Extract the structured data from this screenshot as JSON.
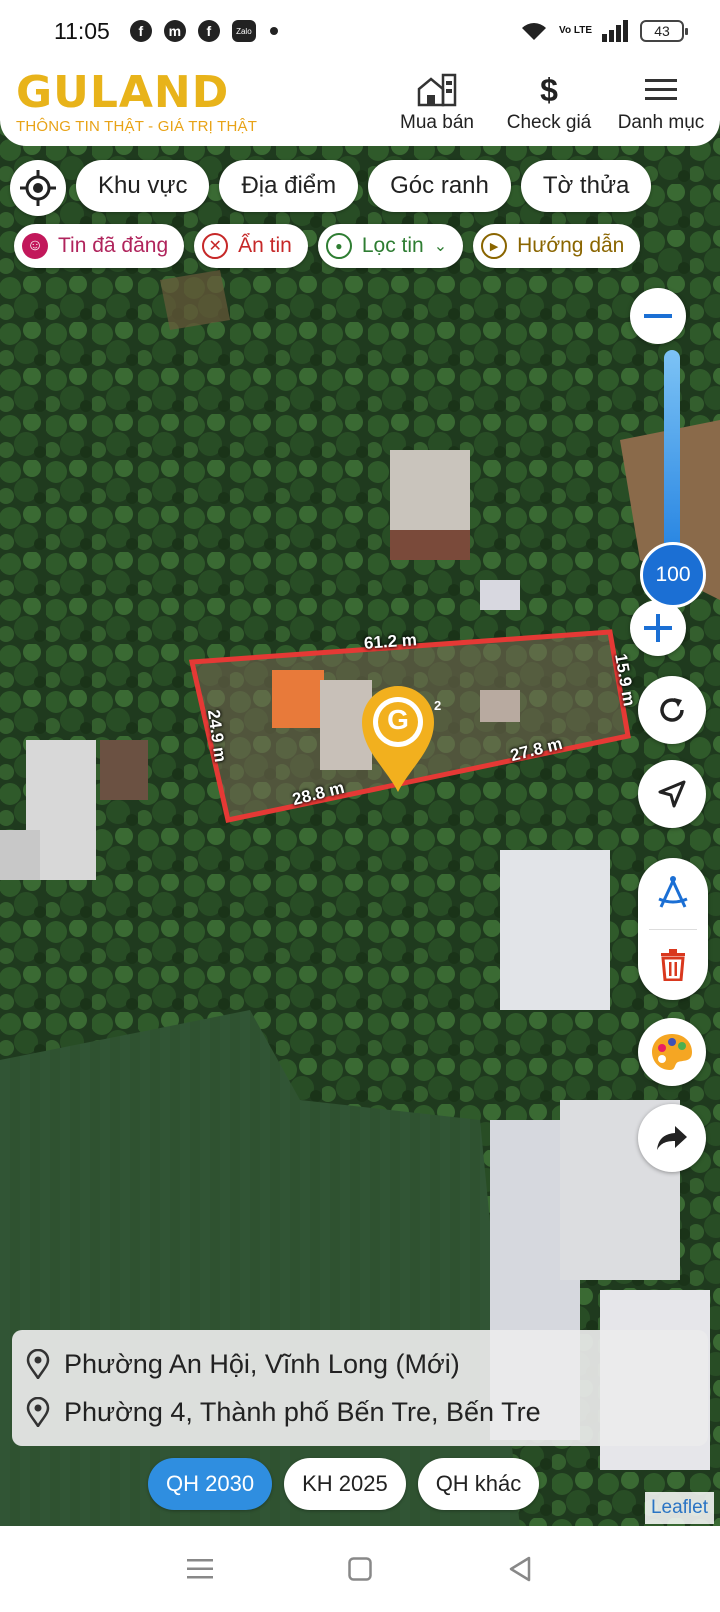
{
  "status_bar": {
    "time": "11:05",
    "notification_icons": [
      "facebook-icon",
      "messenger-icon",
      "facebook-icon",
      "zalo-icon"
    ],
    "zalo_label": "Zalo",
    "volte": "Vo LTE",
    "battery": "43"
  },
  "header": {
    "logo_text": "GULAND",
    "slogan": "THÔNG TIN THẬT - GIÁ TRỊ THẬT",
    "nav": [
      {
        "label": "Mua bán",
        "icon": "buildings-icon"
      },
      {
        "label": "Check giá",
        "icon": "dollar-icon"
      },
      {
        "label": "Danh mục",
        "icon": "menu-icon"
      }
    ]
  },
  "filters": {
    "primary": [
      "Khu vực",
      "Địa điểm",
      "Góc ranh",
      "Tờ thửa"
    ],
    "secondary": [
      {
        "label": "Tin đã đăng",
        "icon": "user-posts-icon",
        "color": "#b0245c"
      },
      {
        "label": "Ẩn tin",
        "icon": "hide-icon",
        "color": "#c62828"
      },
      {
        "label": "Lọc tin",
        "icon": "filter-pin-icon",
        "color": "#2e7d32"
      },
      {
        "label": "Hướng dẫn",
        "icon": "guide-play-icon",
        "color": "#8a6500"
      }
    ]
  },
  "map": {
    "zoom_value": "100",
    "parcel": {
      "edges": [
        "61.2 m",
        "15.9 m",
        "27.8 m",
        "28.8 m",
        "24.9 m"
      ],
      "marker_letter": "G",
      "marker_suffix": "2"
    },
    "boundary_color": "#e53935",
    "attribution": "Leaflet"
  },
  "address": {
    "new": "Phường An Hội, Vĩnh Long (Mới)",
    "old": "Phường 4, Thành phố Bến Tre, Bến Tre"
  },
  "plan_tabs": [
    {
      "label": "QH 2030",
      "active": true
    },
    {
      "label": "KH 2025",
      "active": false
    },
    {
      "label": "QH khác",
      "active": false
    }
  ]
}
